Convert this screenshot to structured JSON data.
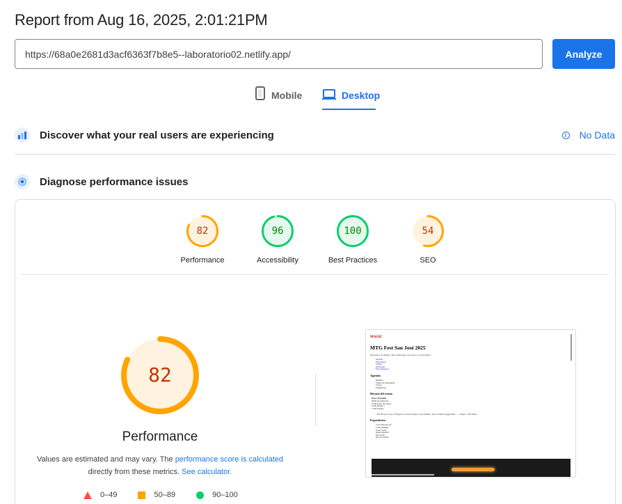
{
  "header": {
    "title": "Report from Aug 16, 2025, 2:01:21PM",
    "url_value": "https://68a0e2681d3acf6363f7b8e5--laboratorio02.netlify.app/",
    "analyze_label": "Analyze"
  },
  "tabs": [
    {
      "label": "Mobile",
      "icon": "phone-icon",
      "active": false
    },
    {
      "label": "Desktop",
      "icon": "laptop-icon",
      "active": true
    }
  ],
  "sections": {
    "discover": {
      "title": "Discover what your real users are experiencing",
      "status": "No Data",
      "icon": "users-chart-icon"
    },
    "diagnose": {
      "title": "Diagnose performance issues",
      "icon": "diagnose-icon"
    }
  },
  "scores": [
    {
      "label": "Performance",
      "value": "82",
      "fraction": 0.82,
      "rating": "average"
    },
    {
      "label": "Accessibility",
      "value": "96",
      "fraction": 0.96,
      "rating": "pass"
    },
    {
      "label": "Best Practices",
      "value": "100",
      "fraction": 1.0,
      "rating": "pass"
    },
    {
      "label": "SEO",
      "value": "54",
      "fraction": 0.54,
      "rating": "average"
    }
  ],
  "colors": {
    "accent": "#1a73e8",
    "pass": "#0cce6b",
    "pass_text": "#008800",
    "average": "#ffa400",
    "average_text": "#c33300",
    "fail": "#ff4e42"
  },
  "performance": {
    "value": "82",
    "fraction": 0.82,
    "title": "Performance",
    "note_prefix": "Values are estimated and may vary. The ",
    "note_link1": "performance score is calculated",
    "note_mid": " directly from these metrics. ",
    "note_link2": "See calculator."
  },
  "legend": [
    {
      "range": "0–49",
      "shape": "triangle",
      "color": "#ff4e42"
    },
    {
      "range": "50–89",
      "shape": "square",
      "color": "#ffa400"
    },
    {
      "range": "90–100",
      "shape": "circle",
      "color": "#0cce6b"
    }
  ],
  "preview": {
    "logo": "MAGIC",
    "heading": "MTG Fest San José 2025",
    "intro": "Encuentro de Magic: The Gathering con torneos y actividades.",
    "nav": [
      "Agenda",
      "Expositores",
      "Galería",
      "Ubicación",
      "Patrocinadores"
    ],
    "agenda_title": "Agenda",
    "agenda": [
      "Registro",
      "Charla de bienvenida",
      "Torneo",
      "Premiación"
    ],
    "schedule_title": "Horario del evento",
    "schedule_head": "Hora      Actividad",
    "schedule": [
      "09:00 Acreditación",
      "10:00 Inicio de torneo",
      "13:00 Ronda 5",
      "17:00 Finales"
    ],
    "quote": "\"The Hope Story of Magic's Greatest Player: Kai Budde, The German Juggernaut\" — Magic: The Plans",
    "exhibitors_title": "Expositores",
    "exhibitors": [
      "Caver Buonocore",
      "Colby Phillips",
      "Vlad Lorent",
      "Nattie Rosfeld",
      "Dan Chen",
      "Nora Gottfeldt"
    ]
  }
}
